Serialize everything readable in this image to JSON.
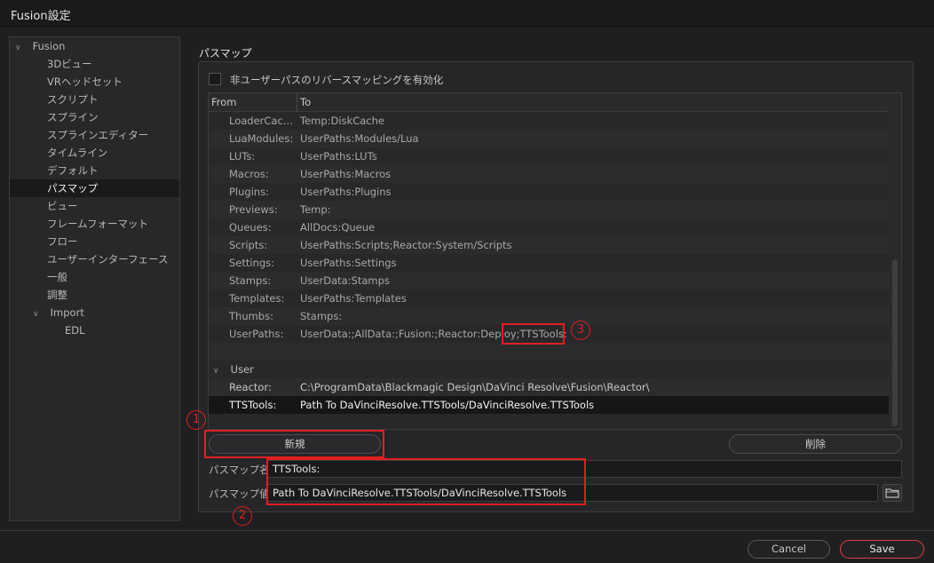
{
  "window": {
    "title": "Fusion設定"
  },
  "sidebar": {
    "items": [
      {
        "label": "Fusion",
        "expandable": true
      },
      {
        "label": "3Dビュー"
      },
      {
        "label": "VRヘッドセット"
      },
      {
        "label": "スクリプト"
      },
      {
        "label": "スプライン"
      },
      {
        "label": "スプラインエディター"
      },
      {
        "label": "タイムライン"
      },
      {
        "label": "デフォルト"
      },
      {
        "label": "パスマップ",
        "selected": true
      },
      {
        "label": "ビュー"
      },
      {
        "label": "フレームフォーマット"
      },
      {
        "label": "フロー"
      },
      {
        "label": "ユーザーインターフェース"
      },
      {
        "label": "一般"
      },
      {
        "label": "調整"
      },
      {
        "label": "Import",
        "expandable": true
      },
      {
        "label": "EDL"
      }
    ]
  },
  "main": {
    "title": "パスマップ",
    "reverse_mapping_label": "非ユーザーパスのリバースマッピングを有効化",
    "columns": {
      "from": "From",
      "to": "To"
    },
    "system_rows": [
      {
        "from": "LoaderCac...",
        "to": "Temp:DiskCache"
      },
      {
        "from": "LuaModules:",
        "to": "UserPaths:Modules/Lua"
      },
      {
        "from": "LUTs:",
        "to": "UserPaths:LUTs"
      },
      {
        "from": "Macros:",
        "to": "UserPaths:Macros"
      },
      {
        "from": "Plugins:",
        "to": "UserPaths:Plugins"
      },
      {
        "from": "Previews:",
        "to": "Temp:"
      },
      {
        "from": "Queues:",
        "to": "AllDocs:Queue"
      },
      {
        "from": "Scripts:",
        "to": "UserPaths:Scripts;Reactor:System/Scripts"
      },
      {
        "from": "Settings:",
        "to": "UserPaths:Settings"
      },
      {
        "from": "Stamps:",
        "to": "UserData:Stamps"
      },
      {
        "from": "Templates:",
        "to": "UserPaths:Templates"
      },
      {
        "from": "Thumbs:",
        "to": "Stamps:"
      },
      {
        "from": "UserPaths:",
        "to": "UserData:;AllData:;Fusion:;Reactor:Deploy;TTSTools:"
      }
    ],
    "user_section_label": "User",
    "user_rows": [
      {
        "from": "Reactor:",
        "to": "C:\\ProgramData\\Blackmagic Design\\DaVinci Resolve\\Fusion\\Reactor\\"
      },
      {
        "from": "TTSTools:",
        "to": "Path To DaVinciResolve.TTSTools/DaVinciResolve.TTSTools",
        "selected": true
      }
    ],
    "new_button": "新規",
    "delete_button": "削除",
    "name_label": "パスマップ名 :",
    "name_value": "TTSTools:",
    "value_label": "パスマップ値 :",
    "value_value": "Path To DaVinciResolve.TTSTools/DaVinciResolve.TTSTools",
    "folder_icon": "folder-icon"
  },
  "footer": {
    "cancel": "Cancel",
    "save": "Save"
  },
  "annotations": {
    "one": "1",
    "two": "2",
    "three": "3",
    "color": "#e01f1f"
  }
}
